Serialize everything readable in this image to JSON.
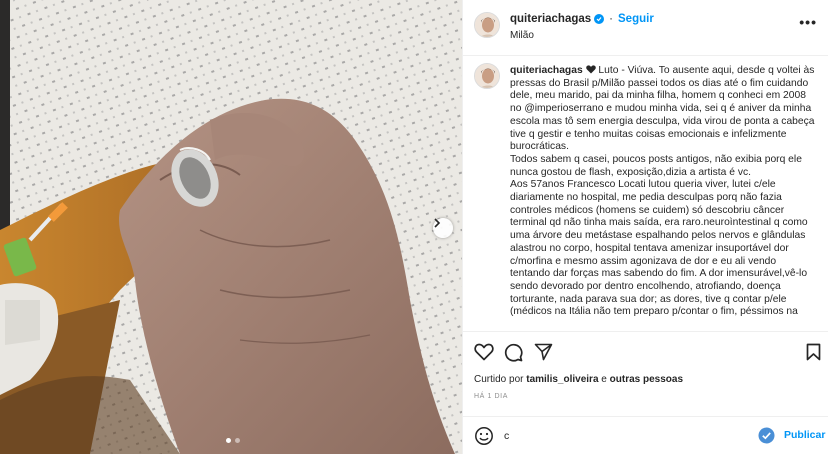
{
  "post": {
    "username": "quiteriachagas",
    "follow_label": "Seguir",
    "location": "Milão",
    "more_label": "•••",
    "caption_text": " Luto - Viúva. To ausente aqui, desde q voltei às pressas do Brasil p/Milão passei todos os dias até o fim cuidando dele, meu marido, pai da minha filha, homem q conheci em 2008 no @imperioserrano e mudou minha vida, sei q é aniver da minha escola mas tô sem energia desculpa, vida virou de ponta a cabeça tive q gestir e tenho muitas coisas emocionais e infelizmente burocráticas.\nTodos sabem q casei, poucos posts antigos, não exibia porq ele nunca gostou de flash, exposição,dizia a artista é vc.\nAos 57anos Francesco Locati lutou queria viver, lutei c/ele diariamente no hospital, me pedia desculpas porq não fazia controles médicos (homens se cuidem) só descobriu câncer terminal qd não tinha mais saída, era raro.neuroìntestinal q como uma árvore deu metástase espalhando pelos nervos e glândulas alastrou no corpo, hospital tentava amenizar insuportável dor c/morfina e mesmo assim agonizava de dor e eu ali vendo tentando dar forças mas sabendo do fim. A dor imensurável,vê-lo sendo devorado por dentro encolhendo, atrofiando, doença torturante, nada parava sua dor; as dores, tive q contar p/ele (médicos na Itália não tem preparo p/contar o fim, péssimos na",
    "liked_prefix": "Curtido por ",
    "liked_user": "tamilis_oliveira",
    "liked_middle": " e ",
    "liked_others": "outras pessoas",
    "timestamp": "HÁ 1 DIA",
    "comment_value": "c",
    "publish_label": "Publicar"
  },
  "carousel": {
    "slide_count": 2,
    "active_index": 0
  },
  "icons": {
    "verified": "verified-badge-icon",
    "like": "heart-icon",
    "comment": "comment-icon",
    "share": "share-icon",
    "save": "bookmark-icon",
    "emoji": "emoji-icon",
    "send": "check-circle-icon",
    "next": "chevron-right-icon"
  },
  "colors": {
    "accent": "#0095f6",
    "text": "#262626",
    "muted": "#8e8e8e"
  }
}
